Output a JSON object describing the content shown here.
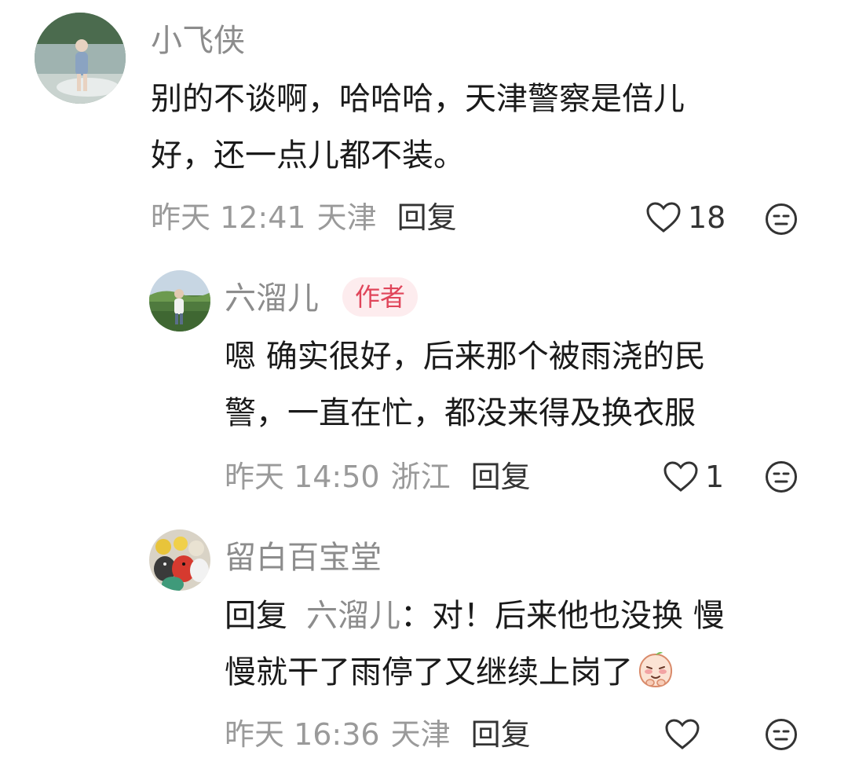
{
  "comments": [
    {
      "username": "小飞侠",
      "lines": [
        "别的不谈啊，哈哈哈，天津警察是倍儿",
        "好，还一点儿都不装。"
      ],
      "time": "昨天 12:41",
      "location": "天津",
      "reply_label": "回复",
      "likes": "18"
    },
    {
      "username": "六溜儿",
      "badge": "作者",
      "lines": [
        "嗯 确实很好，后来那个被雨浇的民",
        "警，一直在忙，都没来得及换衣服"
      ],
      "time": "昨天 14:50",
      "location": "浙江",
      "reply_label": "回复",
      "likes": "1"
    },
    {
      "username": "留白百宝堂",
      "reply_prefix": "回复",
      "reply_target": "六溜儿",
      "reply_colon": "：",
      "lines": [
        "对！后来他也没换 慢",
        "慢就干了雨停了又继续上岗了"
      ],
      "time": "昨天 16:36",
      "location": "天津",
      "reply_label": "回复",
      "likes": ""
    }
  ],
  "icons": {
    "like": "heart-outline-icon",
    "dislike": "unhappy-face-icon"
  },
  "colors": {
    "username": "#8c8c8c",
    "badge_bg": "#fdecee",
    "badge_text": "#e0455a",
    "meta": "#9a9a9a"
  }
}
